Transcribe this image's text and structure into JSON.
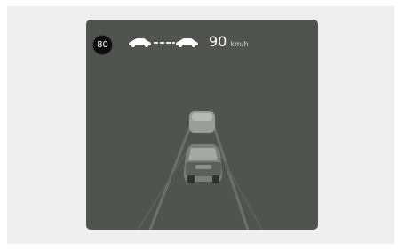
{
  "speed_limit": {
    "value": "80"
  },
  "cruise": {
    "set_speed": "90",
    "unit": "km/h"
  },
  "icons": {
    "speed_limit_sign": "speed-limit-sign-icon",
    "following_distance": "following-distance-icon",
    "lead_vehicle": "lead-vehicle-icon",
    "own_vehicle": "own-vehicle-icon"
  },
  "colors": {
    "screen_background": "#505350",
    "text": "#ffffff",
    "lane_markings": "#6e716e"
  }
}
